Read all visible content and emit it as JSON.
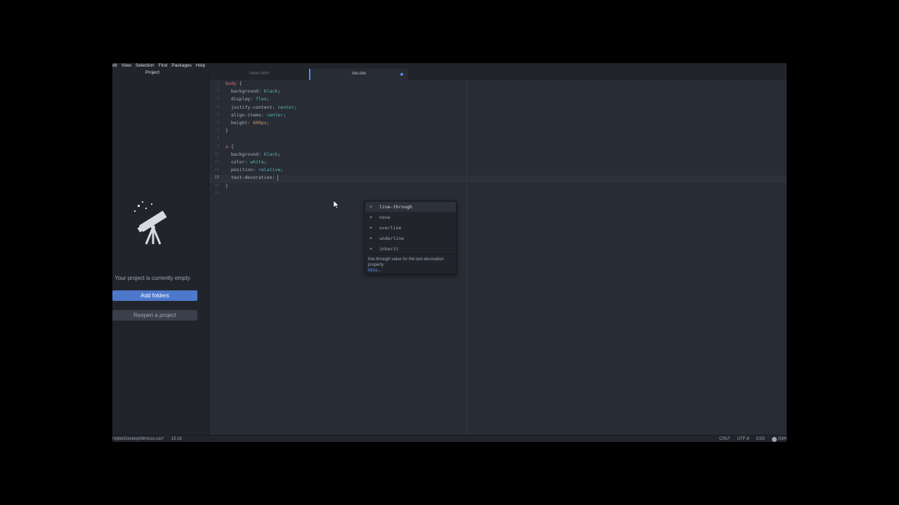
{
  "menubar": {
    "items": [
      "dit",
      "View",
      "Selection",
      "Find",
      "Packages",
      "Help"
    ]
  },
  "treeview": {
    "title": "Project",
    "empty_message": "Your project is currently empty",
    "add_folders": "Add folders",
    "reopen_project": "Reopen a project"
  },
  "tabs": [
    {
      "label": "index.html"
    },
    {
      "label": "css.css"
    }
  ],
  "editor": {
    "line_numbers": [
      "1",
      "2",
      "3",
      "4",
      "5",
      "6",
      "7",
      "8",
      "9",
      "10",
      "11",
      "12",
      "13",
      "14",
      "15"
    ],
    "active_line": "13",
    "code": {
      "l1_sel": "body",
      "l1_brace": " {",
      "l2_prop": "  background:",
      "l2_val": " black",
      "l3_prop": "  display:",
      "l3_val": " flex",
      "l4_prop": "  justify-content:",
      "l4_val": " center",
      "l5_prop": "  align-items:",
      "l5_val": " center",
      "l6_prop": "  height:",
      "l6_val": " 600px",
      "l7": "}",
      "l9_sel": "a",
      "l9_brace": " {",
      "l10_prop": "  background:",
      "l10_val": " black",
      "l11_prop": "  color:",
      "l11_val": " white",
      "l12_prop": "  position:",
      "l12_val": " relative",
      "l13_prop": "  text-decoration:",
      "l14": "}",
      "semi": ";"
    }
  },
  "autocomplete": {
    "items": [
      {
        "type": "●",
        "text": "line-through"
      },
      {
        "type": "●",
        "text": "none"
      },
      {
        "type": "●",
        "text": "overline"
      },
      {
        "type": "●",
        "text": "underline"
      },
      {
        "type": "●",
        "text": "inherit"
      }
    ],
    "description": "line-through value for the text-decoration property",
    "more": "More..."
  },
  "statusbar": {
    "path": "r\\kjlkk\\Desktop\\film\\css.css*",
    "cursor": "13:18",
    "line_ending": "CRLF",
    "encoding": "UTF-8",
    "grammar": "CSS",
    "github": "GitH"
  },
  "colors": {
    "accent": "#4d78cc",
    "selector": "#e06c75",
    "value": "#56b6c2",
    "number": "#d19a66",
    "background": "#282c34"
  }
}
